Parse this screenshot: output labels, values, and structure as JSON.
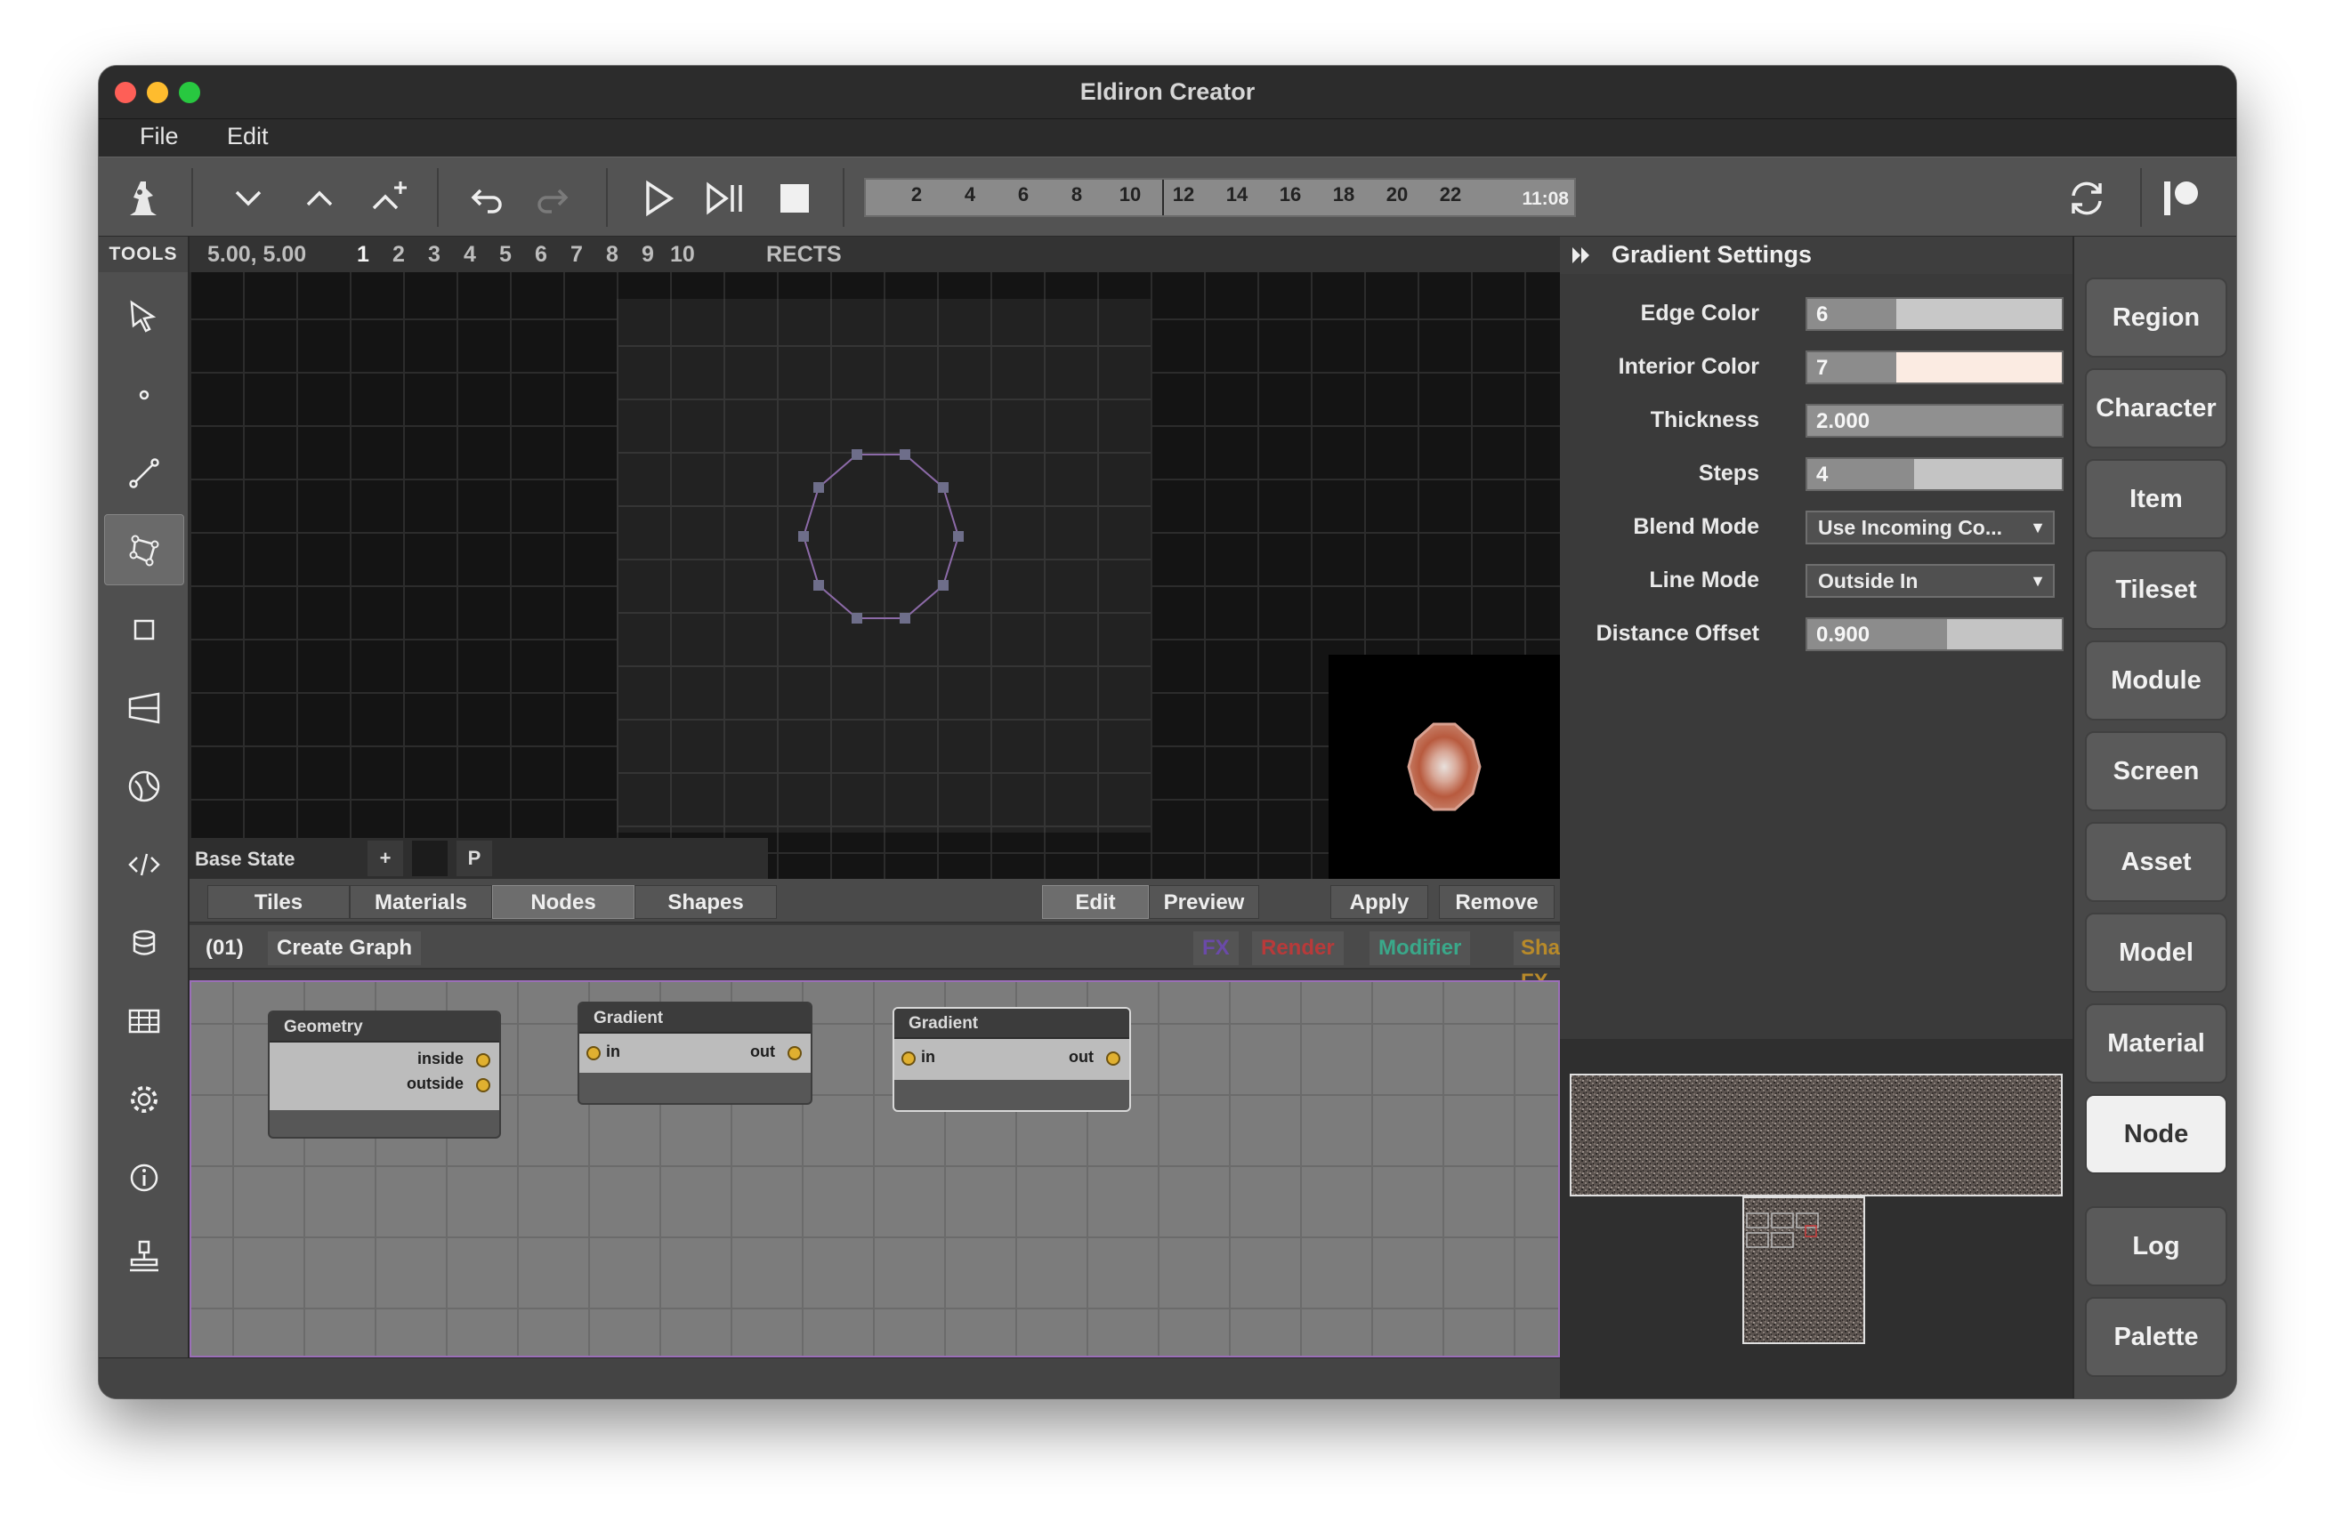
{
  "window": {
    "title": "Eldiron Creator"
  },
  "menu": {
    "file": "File",
    "edit": "Edit"
  },
  "toolbar": {
    "timeline_ticks": [
      "2",
      "4",
      "6",
      "8",
      "10",
      "12",
      "14",
      "16",
      "18",
      "20",
      "22"
    ],
    "time": "11:08"
  },
  "tools": {
    "header": "TOOLS"
  },
  "infobar": {
    "coords": "5.00, 5.00",
    "layers": [
      "1",
      "2",
      "3",
      "4",
      "5",
      "6",
      "7",
      "8",
      "9",
      "10"
    ],
    "mode": "RECTS"
  },
  "state_bar": {
    "state": "Base State",
    "add": "+",
    "p": "P"
  },
  "tabs": {
    "tiles": "Tiles",
    "materials": "Materials",
    "nodes": "Nodes",
    "shapes": "Shapes",
    "edit": "Edit",
    "preview": "Preview",
    "apply": "Apply",
    "remove": "Remove"
  },
  "graph_header": {
    "index": "(01)",
    "create": "Create Graph",
    "fx": "FX",
    "render": "Render",
    "modifier": "Modifier",
    "shape_fx": "Shape FX"
  },
  "graph_colors": {
    "fx": "#6a4aa8",
    "render": "#b83a3a",
    "modifier": "#3aa88a",
    "shape_fx": "#b88a2a"
  },
  "nodes": [
    {
      "title": "Geometry",
      "outputs": [
        "inside",
        "outside"
      ]
    },
    {
      "title": "Gradient",
      "input": "in",
      "output": "out"
    },
    {
      "title": "Gradient",
      "input": "in",
      "output": "out"
    }
  ],
  "settings": {
    "title": "Gradient Settings",
    "rows": [
      {
        "label": "Edge Color",
        "value": "6",
        "fill": 0.35
      },
      {
        "label": "Interior Color",
        "value": "7",
        "fill": 0.35
      },
      {
        "label": "Thickness",
        "value": "2.000",
        "fill": 0.0
      },
      {
        "label": "Steps",
        "value": "4",
        "fill": 0.42
      },
      {
        "label": "Blend Mode",
        "value": "Use Incoming Co..."
      },
      {
        "label": "Line Mode",
        "value": "Outside In"
      },
      {
        "label": "Distance Offset",
        "value": "0.900",
        "fill": 0.55
      }
    ]
  },
  "nav": [
    "Region",
    "Character",
    "Item",
    "Tileset",
    "Module",
    "Screen",
    "Asset",
    "Model",
    "Material",
    "Node",
    "Log",
    "Palette"
  ],
  "nav_selected": "Node"
}
